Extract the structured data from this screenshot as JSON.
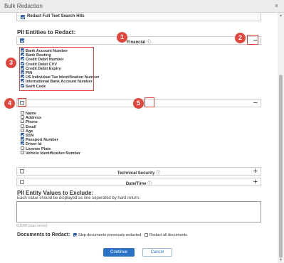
{
  "window": {
    "title": "Bulk Redaction",
    "close_glyph": "×"
  },
  "full_text": {
    "label": "Redact Full Text Search Hits",
    "checked": true
  },
  "pii_heading": "PII Entities to Redact:",
  "groups": [
    {
      "label": "Financial",
      "info_glyph": "ⓘ",
      "toggle": "−",
      "expanded": true,
      "checked": true
    },
    {
      "label": "",
      "info_glyph": "ⓘ",
      "toggle": "−",
      "expanded": true,
      "checked": false
    },
    {
      "label": "Technical Security",
      "info_glyph": "ⓘ",
      "toggle": "+",
      "expanded": false,
      "checked": false
    },
    {
      "label": "Date/Time",
      "info_glyph": "ⓘ",
      "toggle": "+",
      "expanded": false,
      "checked": false
    }
  ],
  "financial_items": [
    {
      "label": "Bank Account Number",
      "checked": true
    },
    {
      "label": "Bank Routing",
      "checked": true
    },
    {
      "label": "Credit Debit Number",
      "checked": true
    },
    {
      "label": "Credit Debit CVV",
      "checked": true
    },
    {
      "label": "Credit Debit Expiry",
      "checked": true
    },
    {
      "label": "PIN",
      "checked": true
    },
    {
      "label": "US Individual Tax Identification Number",
      "checked": true
    },
    {
      "label": "International Bank Account Number",
      "checked": true
    },
    {
      "label": "Swift Code",
      "checked": true
    }
  ],
  "personal_items": [
    {
      "label": "Name",
      "checked": false
    },
    {
      "label": "Address",
      "checked": false
    },
    {
      "label": "Phone",
      "checked": false
    },
    {
      "label": "Email",
      "checked": false
    },
    {
      "label": "Age",
      "checked": false
    },
    {
      "label": "SSN",
      "checked": true
    },
    {
      "label": "Passport Number",
      "checked": true
    },
    {
      "label": "Driver Id",
      "checked": true
    },
    {
      "label": "License Plate",
      "checked": false
    },
    {
      "label": "Vehicle Identification Number",
      "checked": false
    }
  ],
  "exclude": {
    "heading": "PII Entity Values to Exclude:",
    "sub": "Each value should be displayed as line seperated by hard return.",
    "value": "",
    "counter": "0/1000 (max terms)"
  },
  "documents": {
    "heading": "Documents to Redact:",
    "options": [
      {
        "label": "Skip documents previously redacted",
        "checked": true
      },
      {
        "label": "Redact all documents",
        "checked": false
      }
    ]
  },
  "buttons": {
    "continue": "Continue",
    "cancel": "Cancel"
  },
  "markers": [
    "1",
    "2",
    "3",
    "4",
    "5"
  ],
  "colors": {
    "accent": "#2a73c9",
    "marker": "#e0463c",
    "checkbox": "#2f5fa8"
  }
}
